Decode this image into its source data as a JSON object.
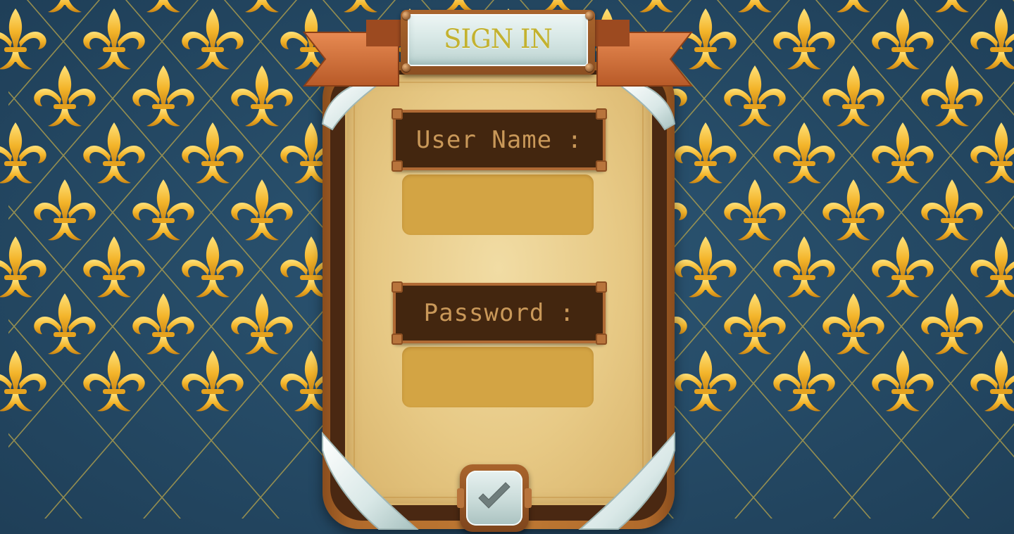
{
  "screen": {
    "title": "SIGN IN",
    "username_label": "User Name :",
    "username_value": "",
    "password_label": "Password :",
    "password_value": "",
    "confirm_icon": "checkmark-icon"
  },
  "colors": {
    "background": "#264b66",
    "fleur": "#f1b82c",
    "lattice": "#b9a54a",
    "board_wood": "#b06a2b",
    "parchment": "#ead08f",
    "label_board": "#43260f",
    "label_text": "#c99859",
    "input_fill": "#d3a444",
    "ribbon": "#d06a34",
    "title_text": "#c3b22f",
    "glass": "#dfeceb"
  }
}
